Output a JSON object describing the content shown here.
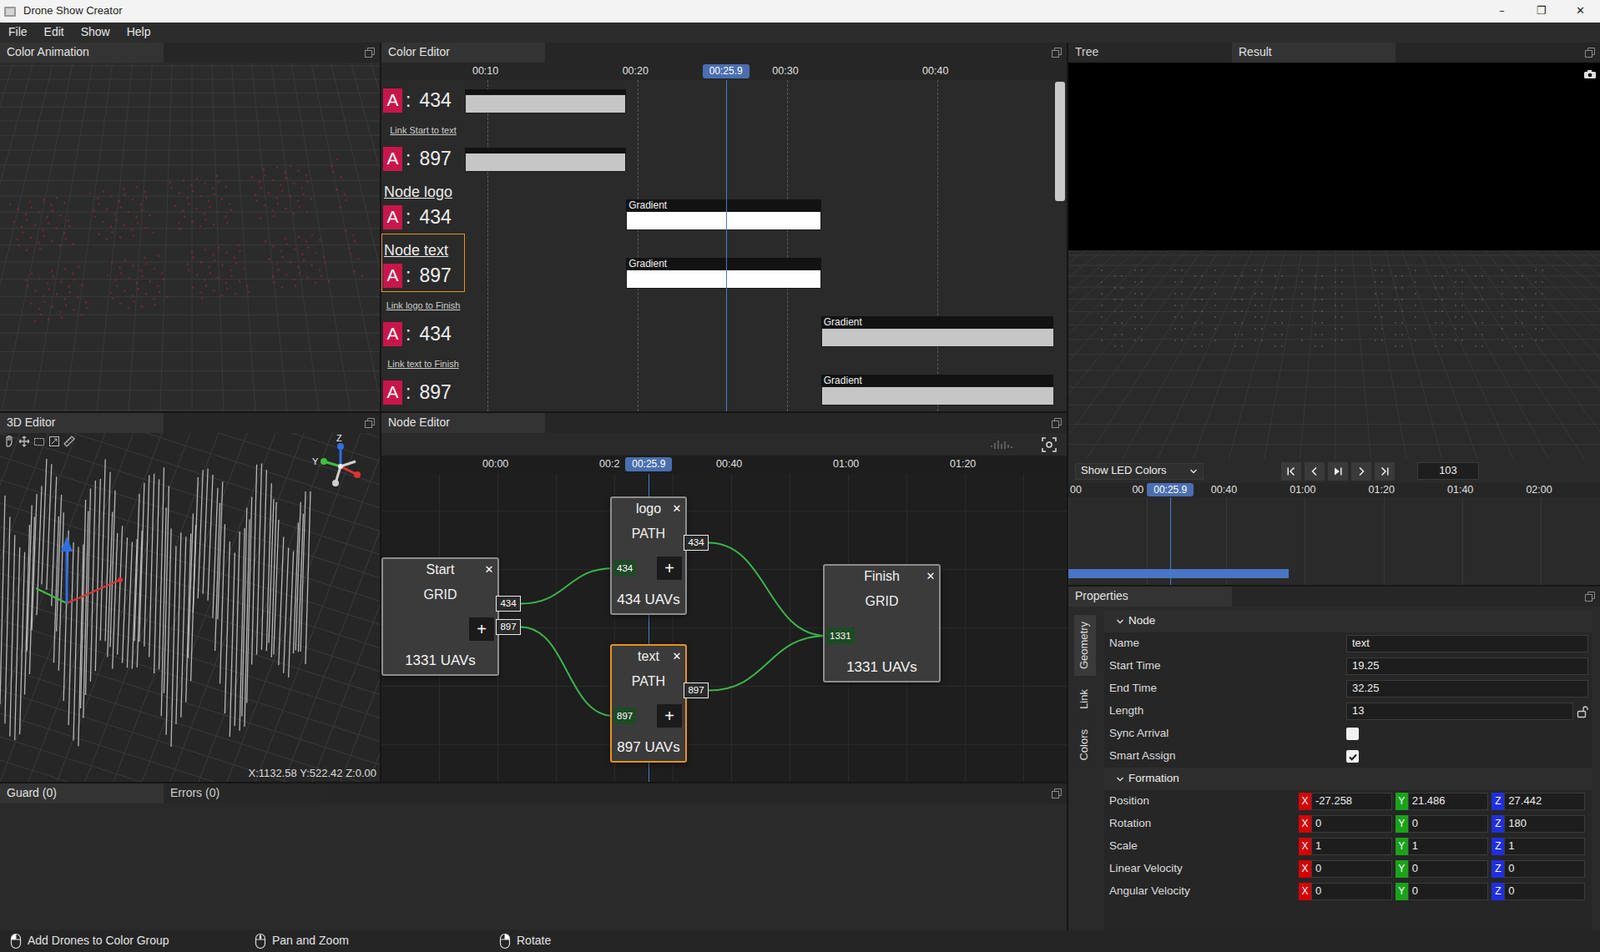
{
  "window": {
    "title": "Drone Show Creator",
    "controls": [
      "–",
      "❐",
      "✕"
    ]
  },
  "menu": [
    "File",
    "Edit",
    "Show",
    "Help"
  ],
  "color_animation": {
    "title": "Color Animation"
  },
  "color_editor": {
    "title": "Color Editor",
    "view_start_s": 8.5,
    "ruler": [
      {
        "label": "00:10",
        "t": 10
      },
      {
        "label": "00:20",
        "t": 20
      },
      {
        "label": "00:30",
        "t": 30
      },
      {
        "label": "00:40",
        "t": 40
      }
    ],
    "playhead": {
      "label": "00:25.9",
      "t": 25.9
    },
    "scrollbar": {
      "level": 0.36
    },
    "rows": [
      {
        "selected": false,
        "badge": "A",
        "sep": ":",
        "count": "434",
        "bar": {
          "kind": "plain",
          "start": 8.5,
          "end": 19.25,
          "color": "#c6c6c6"
        }
      },
      {
        "label": {
          "text": "Link Start to text",
          "kind": "link"
        },
        "selected": false,
        "badge": "A",
        "sep": ":",
        "count": "897",
        "bar": {
          "kind": "plain",
          "start": 8.5,
          "end": 19.25,
          "color": "#c6c6c6"
        }
      },
      {
        "label": {
          "text": "Node logo",
          "kind": "node"
        },
        "selected": false,
        "badge": "A",
        "sep": ":",
        "count": "434",
        "bar": {
          "kind": "gradient",
          "title": "Gradient",
          "start": 19.25,
          "end": 32.25,
          "color": "#ffffff"
        }
      },
      {
        "label": {
          "text": "Node text",
          "kind": "node"
        },
        "selected": true,
        "badge": "A",
        "sep": ":",
        "count": "897",
        "bar": {
          "kind": "gradient",
          "title": "Gradient",
          "start": 19.25,
          "end": 32.25,
          "color": "#ffffff"
        }
      },
      {
        "label": {
          "text": "Link logo to Finish",
          "kind": "link"
        },
        "selected": false,
        "badge": "A",
        "sep": ":",
        "count": "434",
        "bar": {
          "kind": "gradient",
          "title": "Gradient",
          "start": 32.25,
          "end": 60,
          "color": "#c6c6c6"
        }
      },
      {
        "label": {
          "text": "Link text to Finish",
          "kind": "link"
        },
        "selected": false,
        "badge": "A",
        "sep": ":",
        "count": "897",
        "bar": {
          "kind": "gradient",
          "title": "Gradient",
          "start": 32.25,
          "end": 60,
          "color": "#c6c6c6"
        }
      }
    ]
  },
  "editor_3d": {
    "title": "3D Editor",
    "gizmo": {
      "z": "Z",
      "y": "Y"
    },
    "cursor": "X:1132.58 Y:522.42 Z:0.00"
  },
  "node_editor": {
    "title": "Node Editor",
    "ruler": [
      {
        "label": "00:00",
        "t": 0
      },
      {
        "label": "00:2",
        "t": 20
      },
      {
        "label": "00:40",
        "t": 40
      },
      {
        "label": "01:00",
        "t": 60
      },
      {
        "label": "01:20",
        "t": 80
      }
    ],
    "playhead": {
      "label": "00:25.9",
      "t": 25.9
    },
    "nodes": [
      {
        "name": "Start",
        "type": "GRID",
        "count": "1331 UAVs",
        "selected": false,
        "close": "✕",
        "add": "+",
        "inputs": [],
        "outputs": [
          "434",
          "897"
        ]
      },
      {
        "name": "logo",
        "type": "PATH",
        "count": "434 UAVs",
        "selected": false,
        "close": "✕",
        "add": "+",
        "inputs": [
          "434"
        ],
        "outputs": [
          "434"
        ]
      },
      {
        "name": "text",
        "type": "PATH",
        "count": "897 UAVs",
        "selected": true,
        "close": "✕",
        "add": "+",
        "inputs": [
          "897"
        ],
        "outputs": [
          "897"
        ]
      },
      {
        "name": "Finish",
        "type": "GRID",
        "count": "1331 UAVs",
        "selected": false,
        "close": "✕",
        "inputs": [
          "1331"
        ],
        "outputs": []
      }
    ],
    "edges": [
      {
        "from": "Start",
        "out": 0,
        "to": "logo",
        "in": 0
      },
      {
        "from": "Start",
        "out": 1,
        "to": "text",
        "in": 0
      },
      {
        "from": "logo",
        "out": 0,
        "to": "Finish",
        "in": 0
      },
      {
        "from": "text",
        "out": 0,
        "to": "Finish",
        "in": 0
      }
    ]
  },
  "bottom": {
    "tabs": [
      {
        "label": "Guard (0)",
        "selected": true
      },
      {
        "label": "Errors (0)",
        "selected": false
      }
    ]
  },
  "tree_result": {
    "tabs": [
      {
        "label": "Tree",
        "selected": false
      },
      {
        "label": "Result",
        "selected": true
      }
    ],
    "view_mode": "Show LED Colors",
    "frame": "103",
    "ruler": [
      {
        "label": "00",
        "t": 0
      },
      {
        "label": "00",
        "t": 20
      },
      {
        "label": "00:40",
        "t": 40
      },
      {
        "label": "01:00",
        "t": 60
      },
      {
        "label": "01:20",
        "t": 80
      },
      {
        "label": "01:40",
        "t": 100
      },
      {
        "label": "02:00",
        "t": 120
      }
    ],
    "playhead": {
      "label": "00:25.9",
      "t": 25.9
    },
    "range": {
      "start": 0,
      "end": 56
    }
  },
  "properties": {
    "title": "Properties",
    "tabs": [
      {
        "label": "Geometry",
        "selected": true
      },
      {
        "label": "Link",
        "selected": false
      },
      {
        "label": "Colors",
        "selected": false
      }
    ],
    "sections": [
      {
        "title": "Node",
        "expanded": true,
        "fields": [
          {
            "label": "Name",
            "kind": "text",
            "value": "text"
          },
          {
            "label": "Start Time",
            "kind": "text",
            "value": "19.25"
          },
          {
            "label": "End Time",
            "kind": "text",
            "value": "32.25"
          },
          {
            "label": "Length",
            "kind": "locked",
            "value": "13"
          },
          {
            "label": "Sync Arrival",
            "kind": "check",
            "checked": false
          },
          {
            "label": "Smart Assign",
            "kind": "check",
            "checked": true
          }
        ]
      },
      {
        "title": "Formation",
        "expanded": true,
        "fields": [
          {
            "label": "Position",
            "kind": "xyz",
            "axes": [
              {
                "axis": "X",
                "value": "-27.258",
                "color": "#d40000"
              },
              {
                "axis": "Y",
                "value": "21.486",
                "color": "#1aa31a"
              },
              {
                "axis": "Z",
                "value": "27.442",
                "color": "#1f2fe0"
              }
            ]
          },
          {
            "label": "Rotation",
            "kind": "xyz",
            "axes": [
              {
                "axis": "X",
                "value": "0",
                "color": "#d40000"
              },
              {
                "axis": "Y",
                "value": "0",
                "color": "#1aa31a"
              },
              {
                "axis": "Z",
                "value": "180",
                "color": "#1f2fe0"
              }
            ]
          },
          {
            "label": "Scale",
            "kind": "xyz",
            "axes": [
              {
                "axis": "X",
                "value": "1",
                "color": "#d40000"
              },
              {
                "axis": "Y",
                "value": "1",
                "color": "#1aa31a"
              },
              {
                "axis": "Z",
                "value": "1",
                "color": "#1f2fe0"
              }
            ]
          },
          {
            "label": "Linear Velocity",
            "kind": "xyz",
            "axes": [
              {
                "axis": "X",
                "value": "0",
                "color": "#d40000"
              },
              {
                "axis": "Y",
                "value": "0",
                "color": "#1aa31a"
              },
              {
                "axis": "Z",
                "value": "0",
                "color": "#1f2fe0"
              }
            ]
          },
          {
            "label": "Angular Velocity",
            "kind": "xyz",
            "axes": [
              {
                "axis": "X",
                "value": "0",
                "color": "#d40000"
              },
              {
                "axis": "Y",
                "value": "0",
                "color": "#1aa31a"
              },
              {
                "axis": "Z",
                "value": "0",
                "color": "#1f2fe0"
              }
            ]
          }
        ]
      }
    ]
  },
  "status_bar": [
    {
      "label": "Add Drones to Color Group",
      "kind": "left"
    },
    {
      "label": "Pan and Zoom",
      "kind": "middle"
    },
    {
      "label": "Rotate",
      "kind": "right"
    }
  ]
}
